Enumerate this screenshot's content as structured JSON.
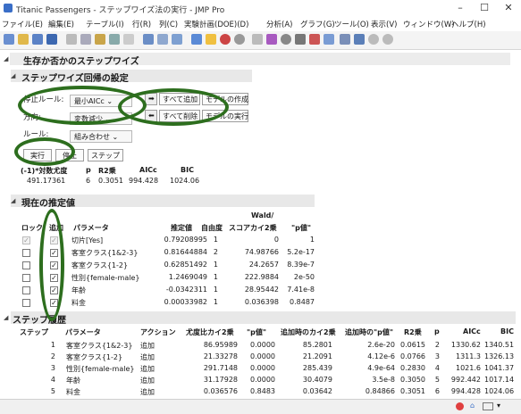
{
  "window": {
    "title": "Titanic Passengers - ステップワイズ法の実行 - JMP Pro",
    "minimize": "–",
    "maximize": "☐",
    "close": "✕"
  },
  "menu": [
    "ファイル(E)",
    "編集(E)",
    "テーブル(I)",
    "行(R)",
    "列(C)",
    "実験計画(DOE)(D)",
    "分析(A)",
    "グラフ(G)",
    "ツール(O)",
    "表示(V)",
    "ウィンドウ(W)",
    "ヘルプ(H)"
  ],
  "outline_title": "生存か否かのステップワイズ",
  "settings": {
    "title": "ステップワイズ回帰の設定",
    "stop_rule_label": "停止ルール:",
    "stop_rule_value": "最小AICc",
    "direction_label": "方向:",
    "direction_value": "変数減少",
    "rule_label": "ルール:",
    "rule_value": "組み合わせ",
    "enter_all": "すべて追加",
    "make_model": "モデルの作成",
    "remove_all": "すべて削除",
    "run_model": "モデルの実行",
    "go": "実行",
    "stop": "停止",
    "step": "ステップ"
  },
  "summary": {
    "headers": [
      "(-1)*対数尤度",
      "p",
      "R2乗",
      "AICc",
      "BIC"
    ],
    "values": [
      "491.17361",
      "6",
      "0.3051",
      "994.428",
      "1024.06"
    ]
  },
  "current": {
    "title": "現在の推定値",
    "wald_header": "Wald/",
    "headers": [
      "ロック",
      "追加",
      "パラメータ",
      "推定値",
      "自由度",
      "スコアカイ2乗",
      "\"p値\""
    ],
    "rows": [
      {
        "param": "切片[Yes]",
        "estimate": "0.79208995",
        "df": "1",
        "chisq": "0",
        "p": "1"
      },
      {
        "param": "客室クラス{1&2-3}",
        "estimate": "0.81644884",
        "df": "2",
        "chisq": "74.98766",
        "p": "5.2e-17"
      },
      {
        "param": "客室クラス{1-2}",
        "estimate": "0.62851492",
        "df": "1",
        "chisq": "24.2657",
        "p": "8.39e-7"
      },
      {
        "param": "性別{female-male}",
        "estimate": "1.2469049",
        "df": "1",
        "chisq": "222.9884",
        "p": "2e-50"
      },
      {
        "param": "年齢",
        "estimate": "-0.0342311",
        "df": "1",
        "chisq": "28.95442",
        "p": "7.41e-8"
      },
      {
        "param": "料金",
        "estimate": "0.00033982",
        "df": "1",
        "chisq": "0.036398",
        "p": "0.8487"
      }
    ]
  },
  "history": {
    "title": "ステップ履歴",
    "headers": [
      "ステップ",
      "パラメータ",
      "アクション",
      "尤度比カイ2乗",
      "\"p値\"",
      "追加時のカイ2乗",
      "追加時の\"p値\"",
      "R2乗",
      "p",
      "AICc",
      "BIC"
    ],
    "rows": [
      [
        "1",
        "客室クラス{1&2-3}",
        "追加",
        "86.95989",
        "0.0000",
        "85.2801",
        "2.6e-20",
        "0.0615",
        "2",
        "1330.62",
        "1340.51"
      ],
      [
        "2",
        "客室クラス{1-2}",
        "追加",
        "21.33278",
        "0.0000",
        "21.2091",
        "4.12e-6",
        "0.0766",
        "3",
        "1311.3",
        "1326.13"
      ],
      [
        "3",
        "性別{female-male}",
        "追加",
        "291.7148",
        "0.0000",
        "285.439",
        "4.9e-64",
        "0.2830",
        "4",
        "1021.6",
        "1041.37"
      ],
      [
        "4",
        "年齢",
        "追加",
        "31.17928",
        "0.0000",
        "30.4079",
        "3.5e-8",
        "0.3050",
        "5",
        "992.442",
        "1017.14"
      ],
      [
        "5",
        "料金",
        "追加",
        "0.036576",
        "0.8483",
        "0.03642",
        "0.84866",
        "0.3051",
        "6",
        "994.428",
        "1024.06"
      ]
    ]
  },
  "colors": {
    "annotation": "#2d6e1e",
    "accent": "#d33"
  }
}
